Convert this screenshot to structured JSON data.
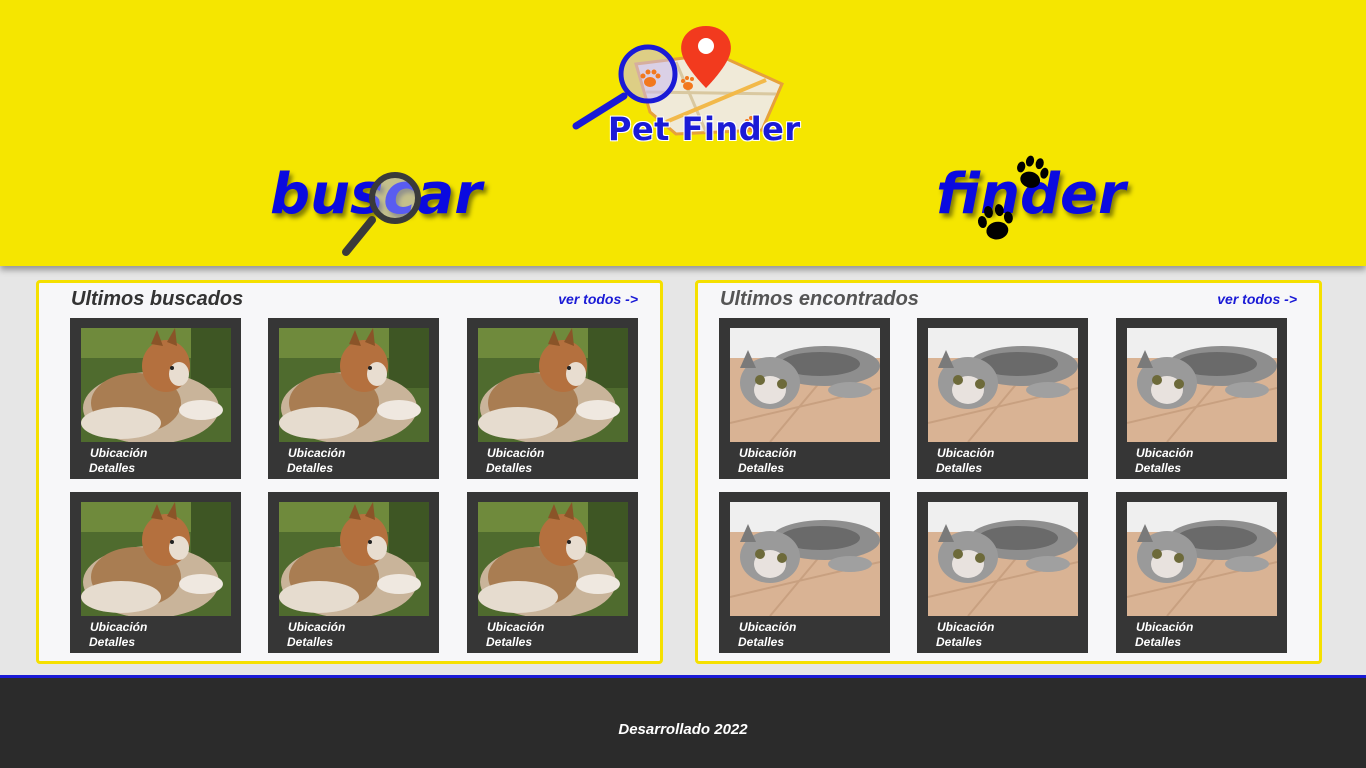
{
  "header": {
    "logo_text": "Pet Finder",
    "nav": [
      {
        "label": "buscar",
        "icon": "magnifier-icon"
      },
      {
        "label": "finder",
        "icon": "paw-prints-icon"
      }
    ]
  },
  "panels": [
    {
      "title": "Ultimos buscados",
      "link": "ver todos ->",
      "photo": "dog-photo",
      "cards": [
        {
          "location": "Ubicación",
          "details": "Detalles"
        },
        {
          "location": "Ubicación",
          "details": "Detalles"
        },
        {
          "location": "Ubicación",
          "details": "Detalles"
        },
        {
          "location": "Ubicación",
          "details": "Detalles"
        },
        {
          "location": "Ubicación",
          "details": "Detalles"
        },
        {
          "location": "Ubicación",
          "details": "Detalles"
        }
      ]
    },
    {
      "title": "Ultimos encontrados",
      "link": "ver todos ->",
      "photo": "cat-photo",
      "cards": [
        {
          "location": "Ubicación",
          "details": "Detalles"
        },
        {
          "location": "Ubicación",
          "details": "Detalles"
        },
        {
          "location": "Ubicación",
          "details": "Detalles"
        },
        {
          "location": "Ubicación",
          "details": "Detalles"
        },
        {
          "location": "Ubicación",
          "details": "Detalles"
        },
        {
          "location": "Ubicación",
          "details": "Detalles"
        }
      ]
    }
  ],
  "footer": {
    "text": "Desarrollado 2022"
  },
  "colors": {
    "header_bg": "#f5e600",
    "accent_blue": "#1a1ad6",
    "card_bg": "#363636",
    "footer_bg": "#2b2b2b"
  }
}
